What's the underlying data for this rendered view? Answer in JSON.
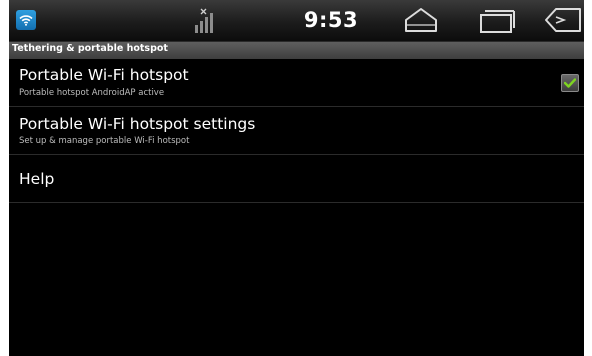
{
  "status_bar": {
    "time": "9:53",
    "notification_icon": "wifi-hotspot-icon",
    "signal_icon": "signal-no-service-icon",
    "nav_buttons": [
      "home-icon",
      "recent-apps-icon",
      "back-icon"
    ]
  },
  "section": {
    "header": "Tethering & portable hotspot"
  },
  "preferences": [
    {
      "title": "Portable Wi-Fi hotspot",
      "summary": "Portable hotspot AndroidAP active",
      "checked": true
    },
    {
      "title": "Portable Wi-Fi hotspot settings",
      "summary": "Set up & manage portable Wi-Fi hotspot"
    },
    {
      "title": "Help"
    }
  ],
  "colors": {
    "background": "#000000",
    "accent_blue": "#1e86cc",
    "check_green": "#7ed321"
  }
}
